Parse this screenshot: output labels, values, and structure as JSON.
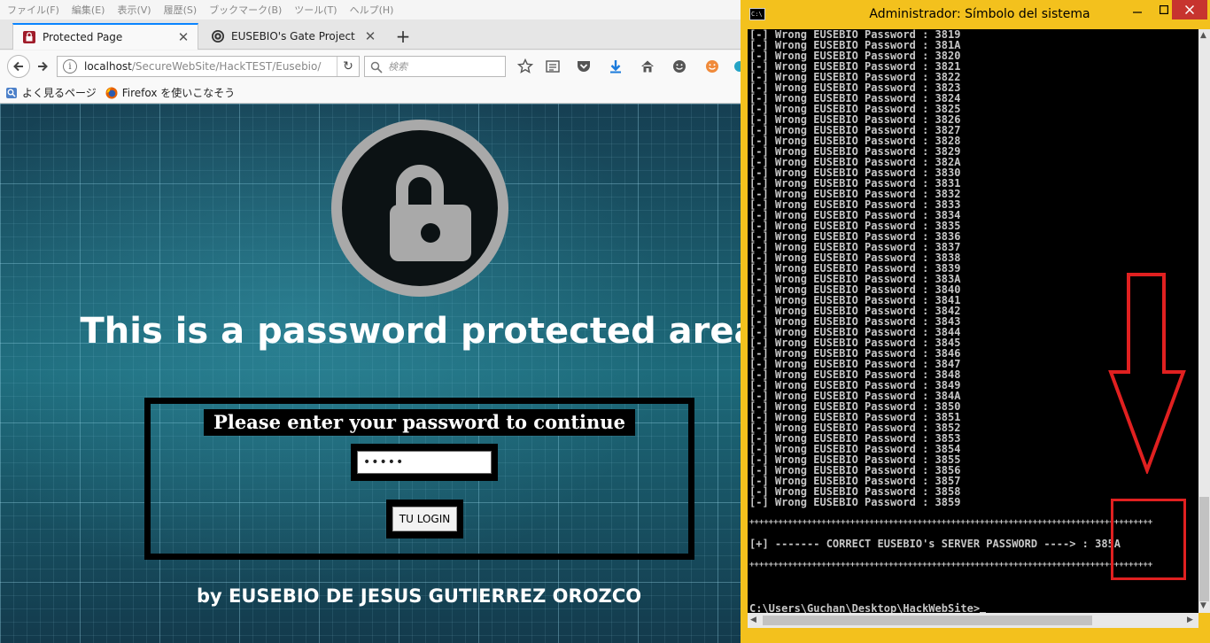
{
  "browser": {
    "menu": [
      "ファイル(F)",
      "編集(E)",
      "表示(V)",
      "履歴(S)",
      "ブックマーク(B)",
      "ツール(T)",
      "ヘルプ(H)"
    ],
    "tabs": [
      {
        "label": "Protected Page"
      },
      {
        "label": "EUSEBIO's Gate Project"
      }
    ],
    "new_tab": "+",
    "url_host": "localhost",
    "url_path": "/SecureWebSite/HackTEST/Eusebio/",
    "search_placeholder": "検索",
    "bookmarks": [
      {
        "label": "よく見るページ"
      },
      {
        "label": "Firefox を使いこなそう"
      }
    ]
  },
  "page": {
    "title": "This is a password protected area",
    "prompt": "Please enter your password to continue",
    "password_value": "•••••",
    "login_label": "TU LOGIN",
    "author": "by EUSEBIO DE JESUS GUTIERREZ OROZCO"
  },
  "cmd": {
    "icon_text": "C:\\",
    "title": "Administrador: Símbolo del sistema",
    "lines": [
      "[-] Wrong EUSEBIO Password : 3819",
      "[-] Wrong EUSEBIO Password : 381A",
      "[-] Wrong EUSEBIO Password : 3820",
      "[-] Wrong EUSEBIO Password : 3821",
      "[-] Wrong EUSEBIO Password : 3822",
      "[-] Wrong EUSEBIO Password : 3823",
      "[-] Wrong EUSEBIO Password : 3824",
      "[-] Wrong EUSEBIO Password : 3825",
      "[-] Wrong EUSEBIO Password : 3826",
      "[-] Wrong EUSEBIO Password : 3827",
      "[-] Wrong EUSEBIO Password : 3828",
      "[-] Wrong EUSEBIO Password : 3829",
      "[-] Wrong EUSEBIO Password : 382A",
      "[-] Wrong EUSEBIO Password : 3830",
      "[-] Wrong EUSEBIO Password : 3831",
      "[-] Wrong EUSEBIO Password : 3832",
      "[-] Wrong EUSEBIO Password : 3833",
      "[-] Wrong EUSEBIO Password : 3834",
      "[-] Wrong EUSEBIO Password : 3835",
      "[-] Wrong EUSEBIO Password : 3836",
      "[-] Wrong EUSEBIO Password : 3837",
      "[-] Wrong EUSEBIO Password : 3838",
      "[-] Wrong EUSEBIO Password : 3839",
      "[-] Wrong EUSEBIO Password : 383A",
      "[-] Wrong EUSEBIO Password : 3840",
      "[-] Wrong EUSEBIO Password : 3841",
      "[-] Wrong EUSEBIO Password : 3842",
      "[-] Wrong EUSEBIO Password : 3843",
      "[-] Wrong EUSEBIO Password : 3844",
      "[-] Wrong EUSEBIO Password : 3845",
      "[-] Wrong EUSEBIO Password : 3846",
      "[-] Wrong EUSEBIO Password : 3847",
      "[-] Wrong EUSEBIO Password : 3848",
      "[-] Wrong EUSEBIO Password : 3849",
      "[-] Wrong EUSEBIO Password : 384A",
      "[-] Wrong EUSEBIO Password : 3850",
      "[-] Wrong EUSEBIO Password : 3851",
      "[-] Wrong EUSEBIO Password : 3852",
      "[-] Wrong EUSEBIO Password : 3853",
      "[-] Wrong EUSEBIO Password : 3854",
      "[-] Wrong EUSEBIO Password : 3855",
      "[-] Wrong EUSEBIO Password : 3856",
      "[-] Wrong EUSEBIO Password : 3857",
      "[-] Wrong EUSEBIO Password : 3858",
      "[-] Wrong EUSEBIO Password : 3859"
    ],
    "separator": "++++++++++++++++++++++++++++++++++++++++++++++++++++++++++++++++++++++++++++++++++++",
    "result": "[+] ------- CORRECT EUSEBIO's SERVER PASSWORD ----> : 385A",
    "prompt": "C:\\Users\\Guchan\\Desktop\\HackWebSite>"
  },
  "colors": {
    "annotation": "#e02020",
    "cmd_titlebar": "#f3c11d",
    "close_button": "#c7342f"
  }
}
